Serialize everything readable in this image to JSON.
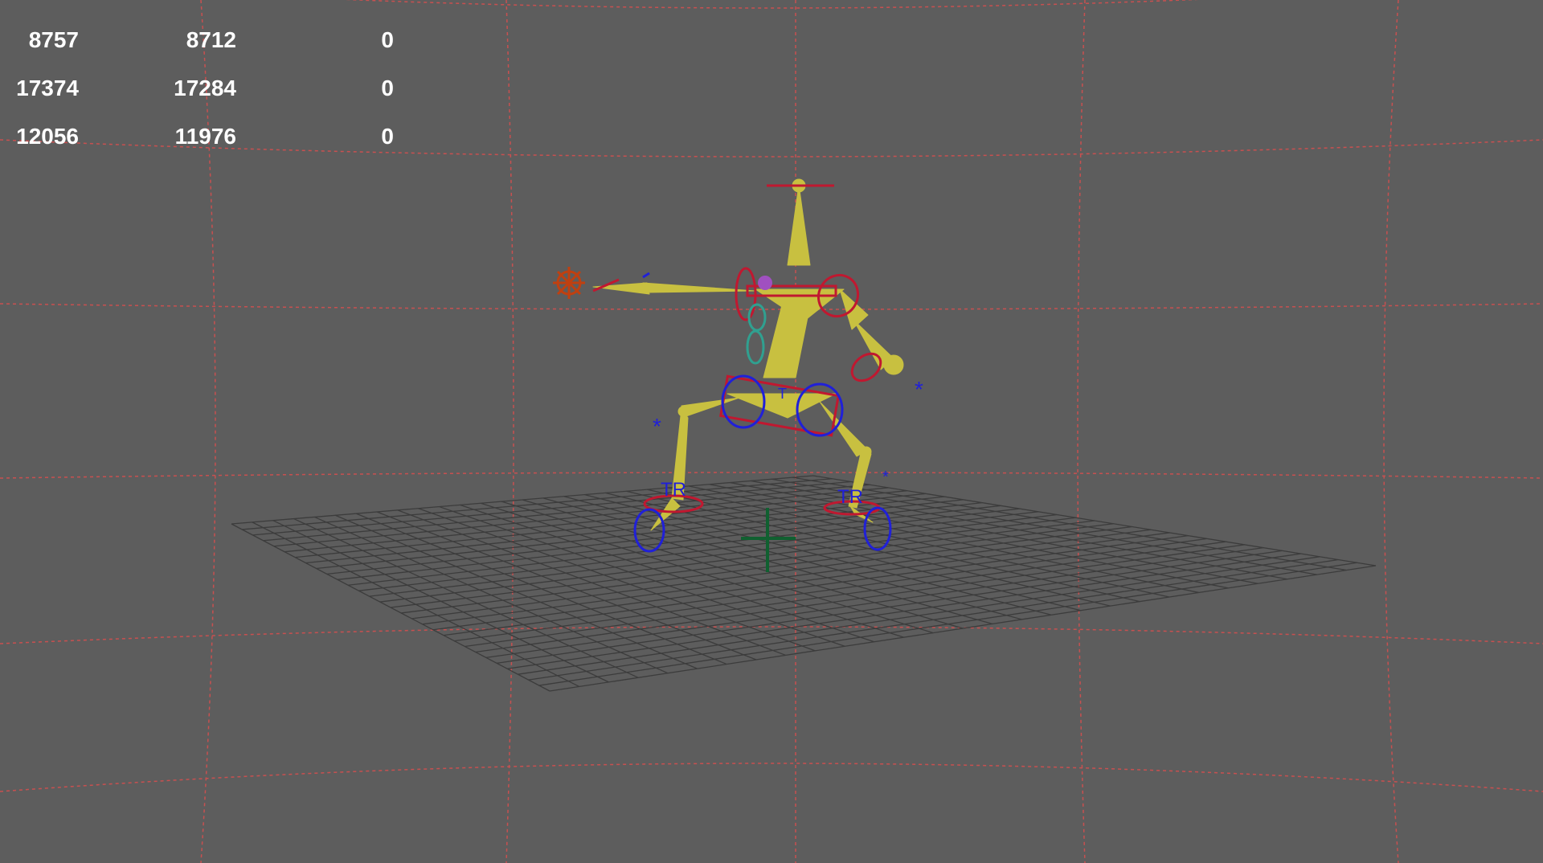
{
  "viewport": {
    "background_color": "#5d5d5d",
    "grid_color": "#c85050",
    "ground_grid_color": "#3c3c3c",
    "rig_bone_color": "#c8c040",
    "ik_control_color": "#2020d8",
    "fk_control_color": "#c01830",
    "spine_control_color": "#30a090",
    "origin_marker_color": "#106030",
    "effector_color": "#c04010"
  },
  "heads_up_display": {
    "rows": [
      {
        "col1": "8757",
        "col2": "8712",
        "col3": "0"
      },
      {
        "col1": "17374",
        "col2": "17284",
        "col3": "0"
      },
      {
        "col1": "12056",
        "col2": "11976",
        "col3": "0"
      }
    ]
  },
  "rig_labels": {
    "left_foot_tag": "TR",
    "right_foot_tag": "TR",
    "hip_tag": "T",
    "pole_markers": [
      "*",
      "*",
      "*"
    ]
  }
}
